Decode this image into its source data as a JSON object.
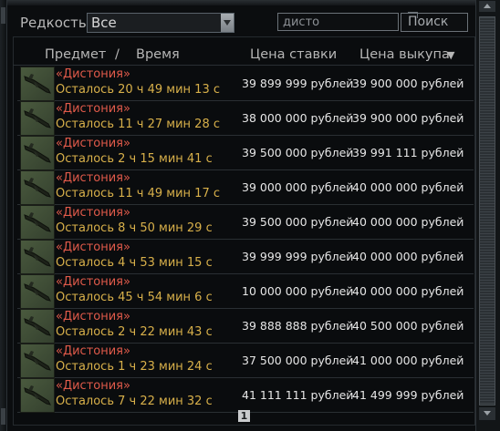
{
  "filter": {
    "rarity_label": "Редкость",
    "rarity_selected": "Все",
    "search_value": "дисто",
    "search_button": "Поиск"
  },
  "columns": {
    "item": "Предмет",
    "separator": "/",
    "time": "Время",
    "bid": "Цена ставки",
    "buyout": "Цена выкупа",
    "sort_icon": "▼"
  },
  "rows": [
    {
      "name": "«Дистония»",
      "time_left": "Осталось 20 ч 49 мин 13 с",
      "bid": "39 899 999 рублей",
      "buyout": "39 900 000 рублей"
    },
    {
      "name": "«Дистония»",
      "time_left": "Осталось 11 ч 27 мин 28 с",
      "bid": "38 000 000 рублей",
      "buyout": "39 900 000 рублей"
    },
    {
      "name": "«Дистония»",
      "time_left": "Осталось 2 ч 15 мин 41 с",
      "bid": "39 500 000 рублей",
      "buyout": "39 991 111 рублей"
    },
    {
      "name": "«Дистония»",
      "time_left": "Осталось 11 ч 49 мин 17 с",
      "bid": "39 000 000 рублей",
      "buyout": "40 000 000 рублей"
    },
    {
      "name": "«Дистония»",
      "time_left": "Осталось 8 ч 50 мин 29 с",
      "bid": "39 500 000 рублей",
      "buyout": "40 000 000 рублей"
    },
    {
      "name": "«Дистония»",
      "time_left": "Осталось 4 ч 53 мин 15 с",
      "bid": "39 999 999 рублей",
      "buyout": "40 000 000 рублей"
    },
    {
      "name": "«Дистония»",
      "time_left": "Осталось 45 ч 54 мин 6 с",
      "bid": "10 000 000 рублей",
      "buyout": "40 000 000 рублей"
    },
    {
      "name": "«Дистония»",
      "time_left": "Осталось 2 ч 22 мин 43 с",
      "bid": "39 888 888 рублей",
      "buyout": "40 500 000 рублей"
    },
    {
      "name": "«Дистония»",
      "time_left": "Осталось 1 ч 23 мин 24 с",
      "bid": "37 500 000 рублей",
      "buyout": "41 000 000 рублей"
    },
    {
      "name": "«Дистония»",
      "time_left": "Осталось 7 ч 22 мин 32 с",
      "bid": "41 111 111 рублей",
      "buyout": "41 499 999 рублей"
    }
  ],
  "pager": {
    "current_page": "1"
  },
  "icons": {
    "item_icon": "weapon-rifle-icon",
    "dropdown": "chevron-down-icon",
    "sort": "sort-desc-icon"
  }
}
